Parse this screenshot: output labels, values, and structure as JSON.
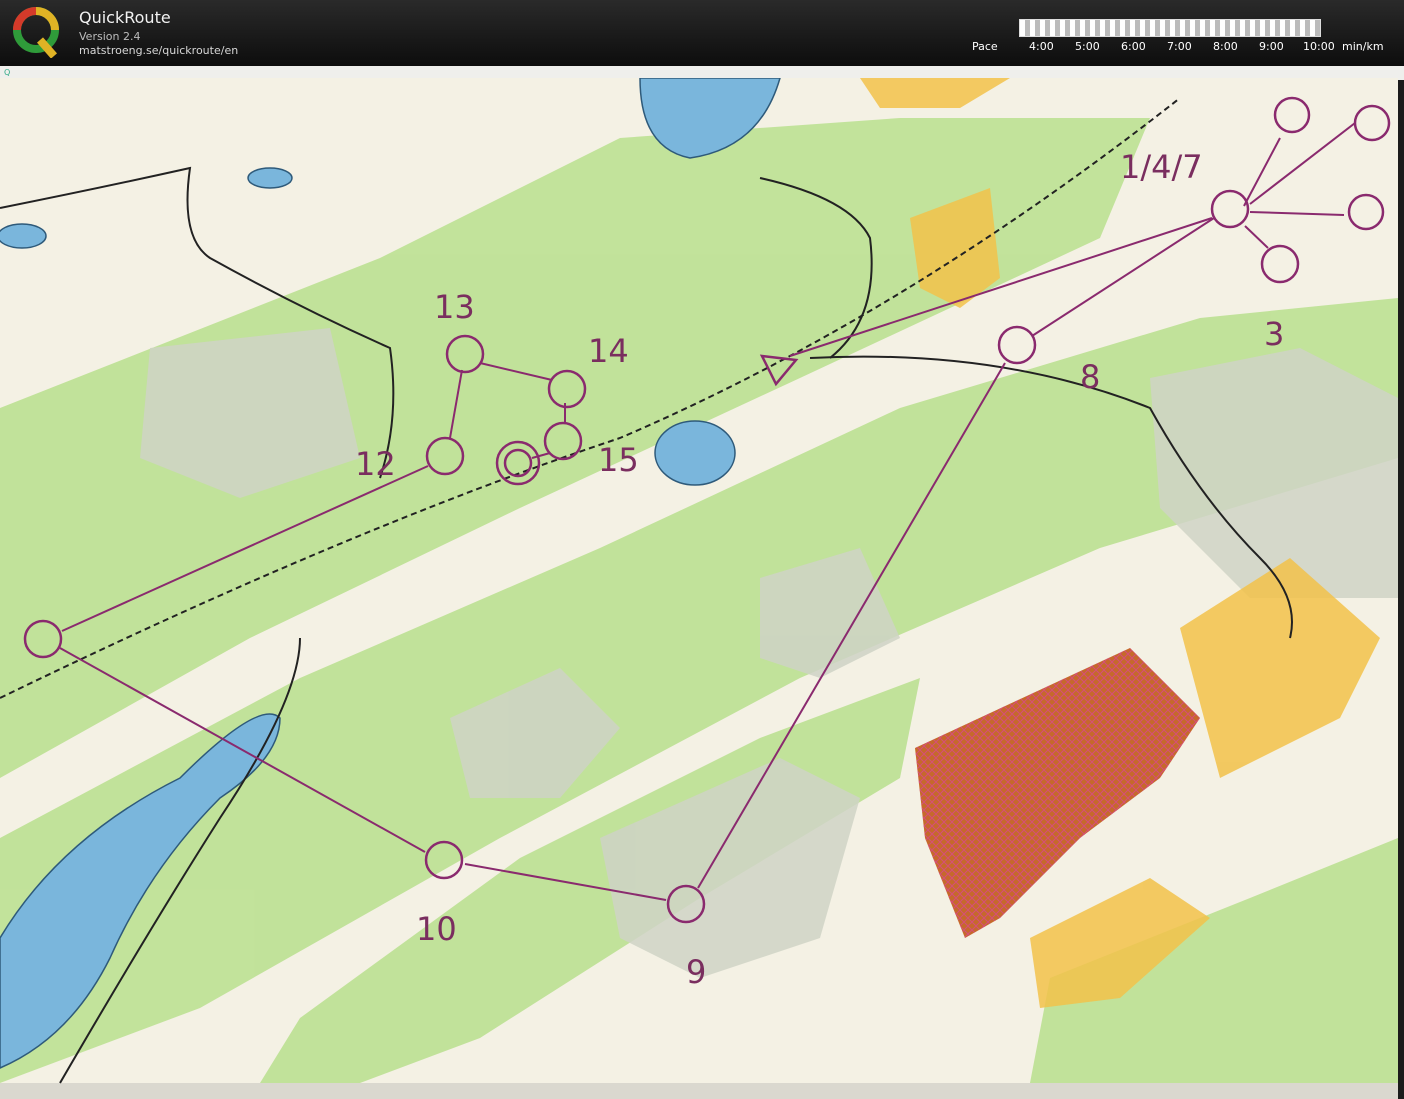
{
  "app": {
    "title": "QuickRoute",
    "version": "Version 2.4",
    "url": "matstroeng.se/quickroute/en"
  },
  "pace": {
    "label": "Pace",
    "ticks": [
      "4:00",
      "5:00",
      "6:00",
      "7:00",
      "8:00",
      "9:00",
      "10:00"
    ],
    "unit": "min/km"
  },
  "colors": {
    "course": "#8a2a6e",
    "water": "#7ab6dc",
    "forest": "#b9e08e",
    "open": "#f2c24a",
    "rough": "#d7d7c8",
    "restricted": "#c6692b"
  },
  "controls": [
    {
      "label": "1/4/7"
    },
    {
      "label": "3"
    },
    {
      "label": "8"
    },
    {
      "label": "9"
    },
    {
      "label": "10"
    },
    {
      "label": "12"
    },
    {
      "label": "13"
    },
    {
      "label": "14"
    },
    {
      "label": "15"
    }
  ]
}
